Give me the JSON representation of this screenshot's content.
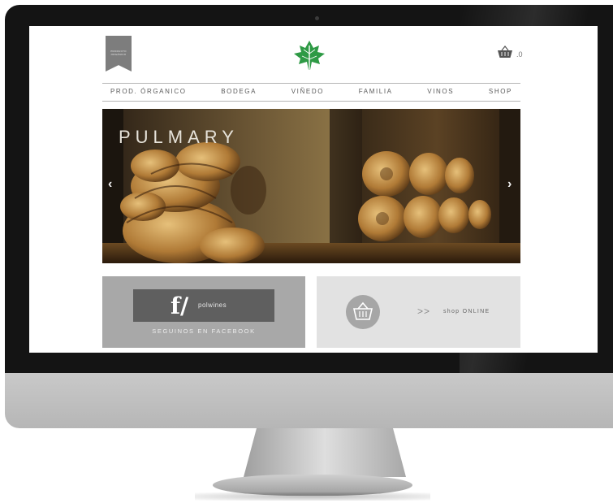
{
  "badge": {
    "text": "producto orgánico"
  },
  "header": {
    "logo_icon": "leaf-logo",
    "cart_icon": "basket-icon",
    "cart_count": ".0"
  },
  "nav": {
    "items": [
      "PROD. ÓRGANICO",
      "BODEGA",
      "VIÑEDO",
      "FAMILIA",
      "VINOS",
      "SHOP"
    ]
  },
  "hero": {
    "title": "PULMARY",
    "prev_icon": "chevron-left-icon",
    "next_icon": "chevron-right-icon",
    "prev": "‹",
    "next": "›"
  },
  "facebook": {
    "icon_text": "f/",
    "page_name": "polwines",
    "label": "SEGUINOS EN FACEBOOK"
  },
  "shop": {
    "icon": "basket-icon",
    "arrows": ">>",
    "label": "shop ONLINE"
  },
  "colors": {
    "accent_green": "#2e9a45",
    "nav_text": "#5a5a5a",
    "fb_card": "#a8a8a8",
    "fb_box": "#5f5f5f",
    "shop_card": "#e2e2e2"
  }
}
